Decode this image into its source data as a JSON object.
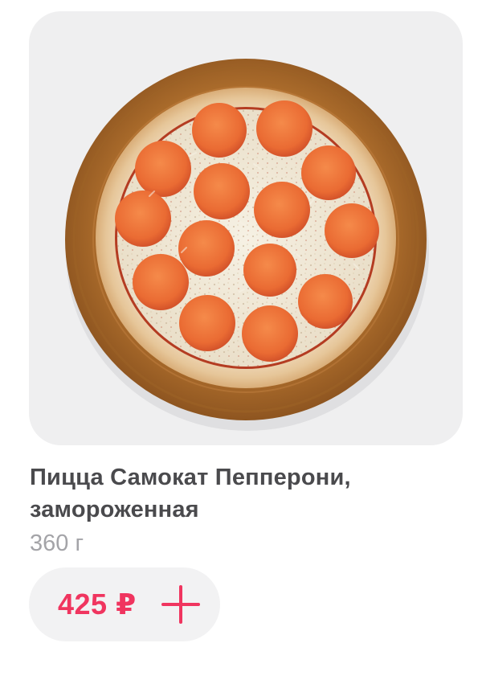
{
  "product": {
    "image_alt": "Pizza pepperoni on wooden board",
    "title": "Пицца Самокат Пепперони, замороженная",
    "weight": "360 г",
    "price": "425 ₽",
    "add_icon": "plus-icon"
  },
  "colors": {
    "accent": "#f0355f",
    "title": "#4a4a4d",
    "muted": "#a4a4a8",
    "surface": "#f2f2f3",
    "image_bg": "#efeff0"
  }
}
